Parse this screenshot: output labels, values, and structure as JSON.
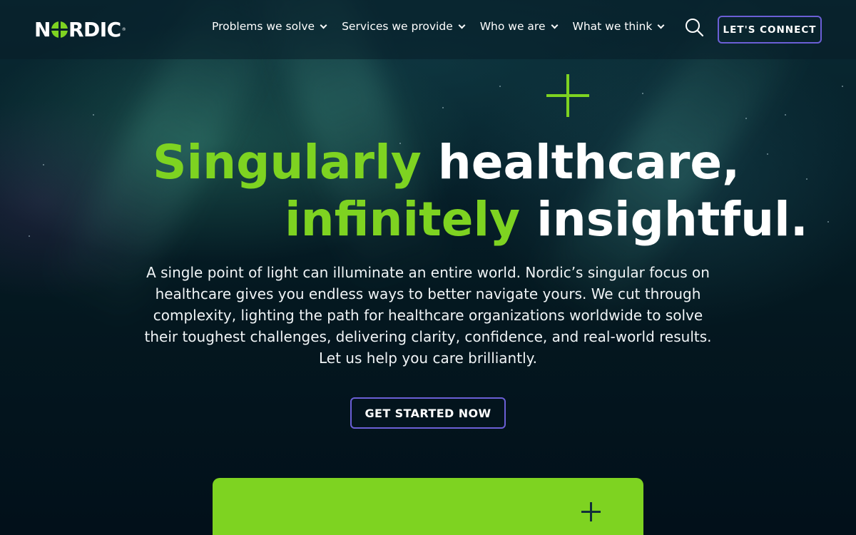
{
  "brand": {
    "name_pre": "N",
    "name_post": "RDIC",
    "trademark": "®",
    "accent": "#7ed321",
    "button_border": "#6b5fd6"
  },
  "nav": {
    "items": [
      {
        "label": "Problems we solve"
      },
      {
        "label": "Services we provide"
      },
      {
        "label": "Who we are"
      },
      {
        "label": "What we think"
      }
    ],
    "search_icon": "search-icon",
    "connect_label": "LET'S CONNECT"
  },
  "hero": {
    "line1_accent": "Singularly",
    "line1_rest": "healthcare,",
    "line2_accent": "infinitely",
    "line2_rest": "insightful.",
    "body": "A single point of light can illuminate an entire world. Nordic’s singular focus on healthcare gives you endless ways to better navigate yours. We cut through complexity, lighting the path for healthcare organizations worldwide to solve their toughest challenges, delivering clarity, confidence, and real-world results. Let us help you care brilliantly.",
    "cta_label": "GET STARTED NOW"
  },
  "card": {
    "icon": "plus-icon"
  }
}
